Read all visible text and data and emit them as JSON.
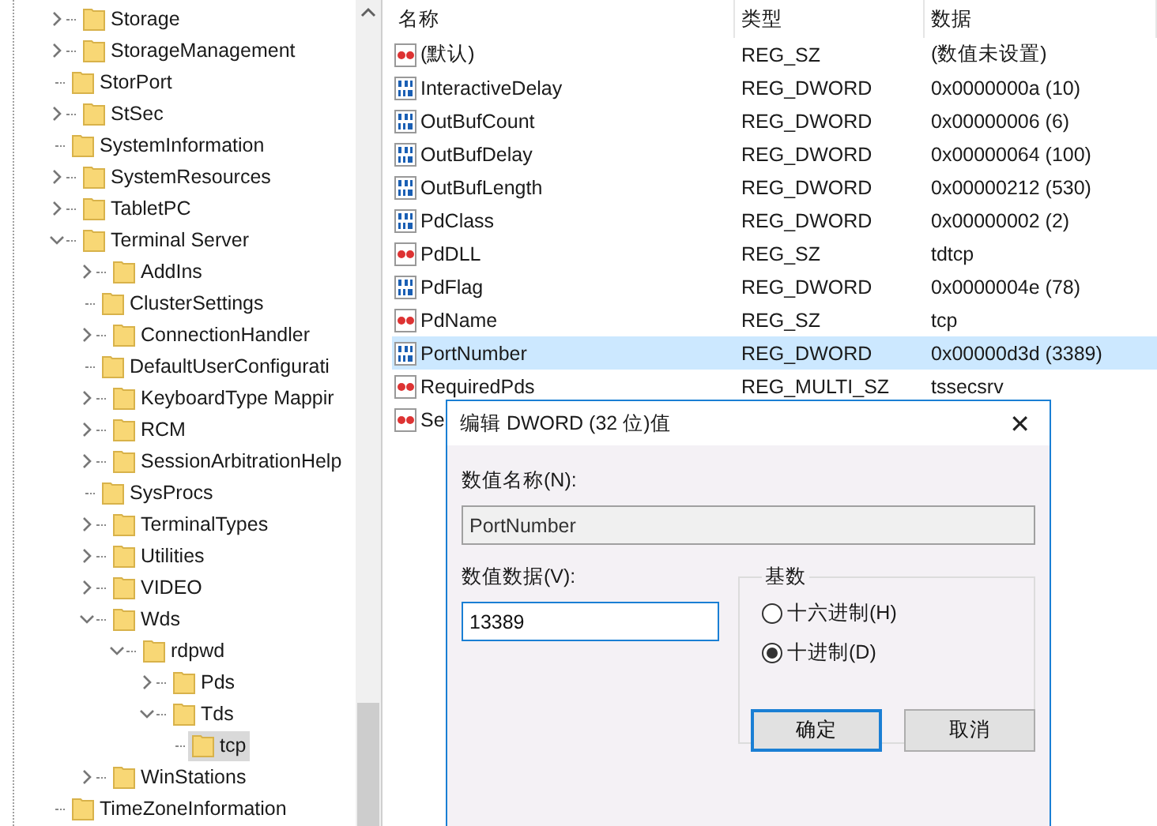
{
  "tree": {
    "items": [
      {
        "label": "Storage",
        "expanded": false,
        "selected": false
      },
      {
        "label": "StorageManagement",
        "expanded": false,
        "selected": false
      },
      {
        "label": "StorPort",
        "selected": false
      },
      {
        "label": "StSec",
        "expanded": false,
        "selected": false
      },
      {
        "label": "SystemInformation",
        "selected": false
      },
      {
        "label": "SystemResources",
        "expanded": false,
        "selected": false
      },
      {
        "label": "TabletPC",
        "expanded": false,
        "selected": false
      },
      {
        "label": "Terminal Server",
        "expanded": true,
        "selected": false,
        "children": [
          {
            "label": "AddIns",
            "expanded": false,
            "selected": false
          },
          {
            "label": "ClusterSettings",
            "selected": false
          },
          {
            "label": "ConnectionHandler",
            "expanded": false,
            "selected": false
          },
          {
            "label": "DefaultUserConfigurati",
            "selected": false
          },
          {
            "label": "KeyboardType Mappir",
            "expanded": false,
            "selected": false
          },
          {
            "label": "RCM",
            "expanded": false,
            "selected": false
          },
          {
            "label": "SessionArbitrationHelp",
            "expanded": false,
            "selected": false
          },
          {
            "label": "SysProcs",
            "selected": false
          },
          {
            "label": "TerminalTypes",
            "expanded": false,
            "selected": false
          },
          {
            "label": "Utilities",
            "expanded": false,
            "selected": false
          },
          {
            "label": "VIDEO",
            "expanded": false,
            "selected": false
          },
          {
            "label": "Wds",
            "expanded": true,
            "selected": false,
            "children": [
              {
                "label": "rdpwd",
                "expanded": true,
                "selected": false,
                "children": [
                  {
                    "label": "Pds",
                    "expanded": false,
                    "selected": false
                  },
                  {
                    "label": "Tds",
                    "expanded": true,
                    "selected": false,
                    "children": [
                      {
                        "label": "tcp",
                        "selected": true
                      }
                    ]
                  }
                ]
              }
            ]
          },
          {
            "label": "WinStations",
            "expanded": false,
            "selected": false
          }
        ]
      },
      {
        "label": "TimeZoneInformation",
        "selected": false
      }
    ]
  },
  "values": {
    "columns": [
      "名称",
      "类型",
      "数据"
    ],
    "rows": [
      {
        "kind": "string",
        "name": "(默认)",
        "type": "REG_SZ",
        "data": "(数值未设置)",
        "selected": false
      },
      {
        "kind": "binary",
        "name": "InteractiveDelay",
        "type": "REG_DWORD",
        "data": "0x0000000a (10)",
        "selected": false
      },
      {
        "kind": "binary",
        "name": "OutBufCount",
        "type": "REG_DWORD",
        "data": "0x00000006 (6)",
        "selected": false
      },
      {
        "kind": "binary",
        "name": "OutBufDelay",
        "type": "REG_DWORD",
        "data": "0x00000064 (100)",
        "selected": false
      },
      {
        "kind": "binary",
        "name": "OutBufLength",
        "type": "REG_DWORD",
        "data": "0x00000212 (530)",
        "selected": false
      },
      {
        "kind": "binary",
        "name": "PdClass",
        "type": "REG_DWORD",
        "data": "0x00000002 (2)",
        "selected": false
      },
      {
        "kind": "string",
        "name": "PdDLL",
        "type": "REG_SZ",
        "data": "tdtcp",
        "selected": false
      },
      {
        "kind": "binary",
        "name": "PdFlag",
        "type": "REG_DWORD",
        "data": "0x0000004e (78)",
        "selected": false
      },
      {
        "kind": "string",
        "name": "PdName",
        "type": "REG_SZ",
        "data": "tcp",
        "selected": false
      },
      {
        "kind": "binary",
        "name": "PortNumber",
        "type": "REG_DWORD",
        "data": "0x00000d3d (3389)",
        "selected": true
      },
      {
        "kind": "string",
        "name": "RequiredPds",
        "type": "REG_MULTI_SZ",
        "data": "tssecsrv",
        "selected": false
      },
      {
        "kind": "string",
        "name": "Se",
        "selected": false
      }
    ]
  },
  "dialog": {
    "title": "编辑 DWORD (32 位)值",
    "close": "✕",
    "name_label": "数值名称(N):",
    "name_value": "PortNumber",
    "data_label": "数值数据(V):",
    "data_value": "13389",
    "base_label": "基数",
    "bases": [
      {
        "label": "十六进制(H)",
        "selected": false
      },
      {
        "label": "十进制(D)",
        "selected": true
      }
    ],
    "buttons": [
      {
        "label": "确定",
        "default": true
      },
      {
        "label": "取消",
        "default": false
      }
    ]
  }
}
